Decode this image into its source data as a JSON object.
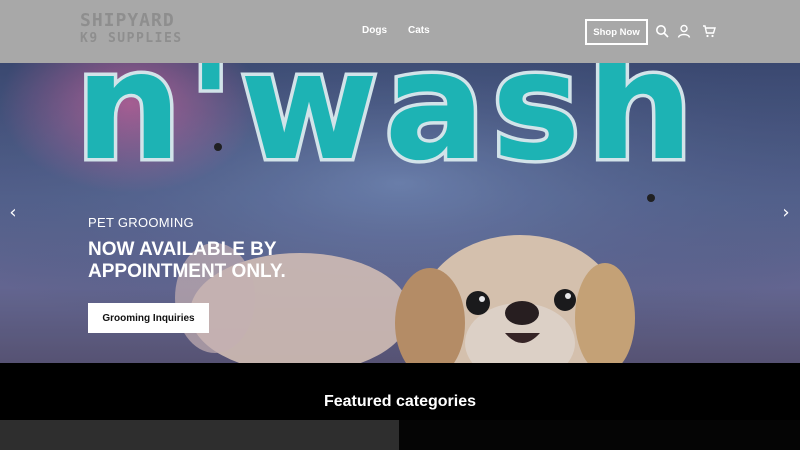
{
  "header": {
    "logo": {
      "line1": "SHIPYARD",
      "line2": "K9 SUPPLIES"
    },
    "nav": [
      {
        "label": "Dogs"
      },
      {
        "label": "Cats"
      }
    ],
    "shop_now_label": "Shop Now",
    "icons": [
      "search-icon",
      "account-icon",
      "cart-icon"
    ]
  },
  "hero": {
    "sign_text": "n'wash",
    "eyebrow": "PET GROOMING",
    "headline": "NOW AVAILABLE BY APPOINTMENT ONLY.",
    "cta_label": "Grooming Inquiries",
    "prev_arrow": "‹",
    "next_arrow": "›"
  },
  "featured": {
    "title": "Featured categories"
  },
  "colors": {
    "header_bg": "#a8a8a8",
    "neon_pink": "#e0357a",
    "neon_teal": "#1fc6c4",
    "button_bg": "#ffffff",
    "page_bg": "#000000"
  }
}
